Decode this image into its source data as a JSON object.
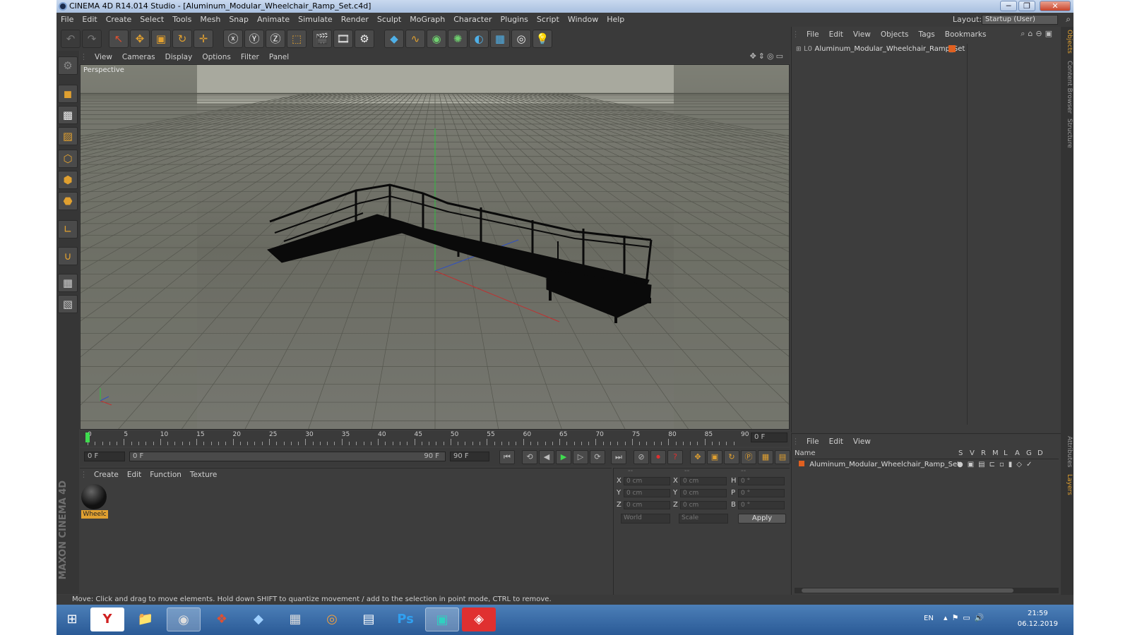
{
  "window": {
    "title": "CINEMA 4D R14.014 Studio - [Aluminum_Modular_Wheelchair_Ramp_Set.c4d]",
    "buttons": [
      "─",
      "❐",
      "✕"
    ]
  },
  "menubar": {
    "items": [
      "File",
      "Edit",
      "Create",
      "Select",
      "Tools",
      "Mesh",
      "Snap",
      "Animate",
      "Simulate",
      "Render",
      "Sculpt",
      "MoGraph",
      "Character",
      "Plugins",
      "Script",
      "Window",
      "Help"
    ],
    "layout_label": "Layout:",
    "layout_value": "Startup (User)"
  },
  "viewport": {
    "menu": [
      "View",
      "Cameras",
      "Display",
      "Options",
      "Filter",
      "Panel"
    ],
    "label": "Perspective"
  },
  "timeline": {
    "ticks": [
      "0",
      "5",
      "10",
      "15",
      "20",
      "25",
      "30",
      "35",
      "40",
      "45",
      "50",
      "55",
      "60",
      "65",
      "70",
      "75",
      "80",
      "85",
      "90"
    ],
    "current_frame": "0 F",
    "start_field": "0 F",
    "range_start": "0 F",
    "range_end": "90 F",
    "end_field": "90 F"
  },
  "materials": {
    "menu": [
      "Create",
      "Edit",
      "Function",
      "Texture"
    ],
    "items": [
      {
        "name": "Wheelc"
      }
    ]
  },
  "coordinates": {
    "header": [
      "--",
      "--",
      "--"
    ],
    "rows": [
      {
        "l1": "X",
        "v1": "0 cm",
        "l2": "X",
        "v2": "0 cm",
        "l3": "H",
        "v3": "0 °"
      },
      {
        "l1": "Y",
        "v1": "0 cm",
        "l2": "Y",
        "v2": "0 cm",
        "l3": "P",
        "v3": "0 °"
      },
      {
        "l1": "Z",
        "v1": "0 cm",
        "l2": "Z",
        "v2": "0 cm",
        "l3": "B",
        "v3": "0 °"
      }
    ],
    "mode": "World",
    "transform": "Scale",
    "apply": "Apply"
  },
  "objects": {
    "menu": [
      "File",
      "Edit",
      "View",
      "Objects",
      "Tags",
      "Bookmarks"
    ],
    "items": [
      {
        "name": "Aluminum_Modular_Wheelchair_Ramp_Set"
      }
    ]
  },
  "layers": {
    "menu": [
      "File",
      "Edit",
      "View"
    ],
    "columns": [
      "Name",
      "S",
      "V",
      "R",
      "M",
      "L",
      "A",
      "G",
      "D"
    ],
    "items": [
      {
        "name": "Aluminum_Modular_Wheelchair_Ramp_Set"
      }
    ]
  },
  "right_tabs": [
    "Objects",
    "Content Browser",
    "Structure",
    "Attributes",
    "Layers"
  ],
  "status": "Move: Click and drag to move elements. Hold down SHIFT to quantize movement / add to the selection in point mode, CTRL to remove.",
  "brand": "MAXON CINEMA 4D",
  "taskbar": {
    "lang": "EN",
    "time": "21:59",
    "date": "06.12.2019"
  },
  "colors": {
    "accent": "#e0a030",
    "viewport_bg": "#6b6c63",
    "object_tag": "#e06020"
  }
}
